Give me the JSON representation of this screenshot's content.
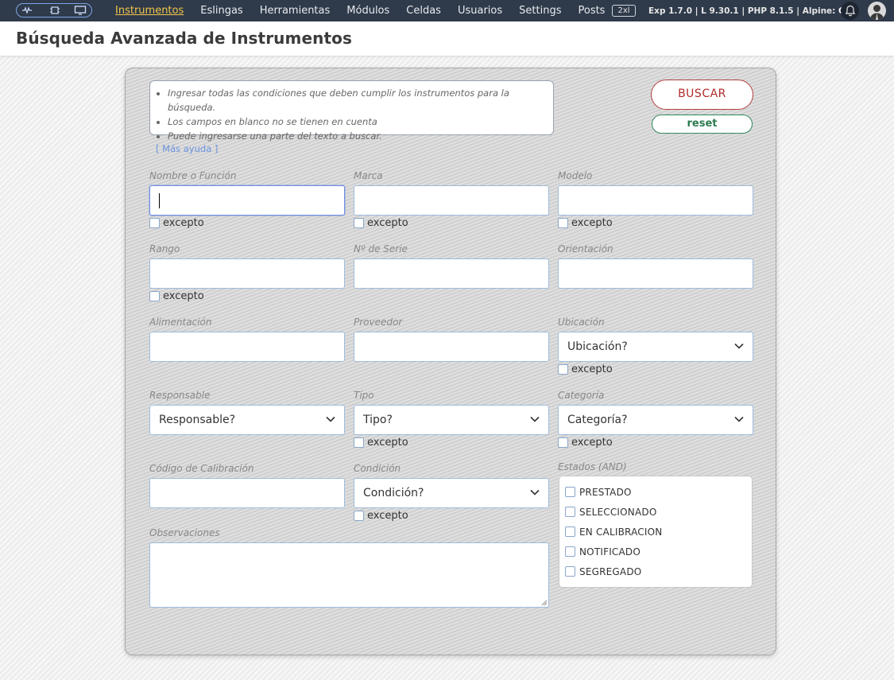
{
  "nav": {
    "items": [
      "Instrumentos",
      "Eslingas",
      "Herramientas",
      "Módulos",
      "Celdas",
      "Usuarios",
      "Settings",
      "Posts"
    ],
    "active": "Instrumentos",
    "breakpoint_badge": "2xl",
    "version_text": "Exp 1.7.0 | L 9.30.1 | PHP 8.1.5 | Alpine:",
    "version_status": "OK",
    "active_color": "#f3c64a",
    "bg_color": "#2f3a4a"
  },
  "page": {
    "title": "Búsqueda Avanzada de Instrumentos"
  },
  "help": {
    "lines": [
      "Ingresar todas las condiciones que deben cumplir los instrumentos para la búsqueda.",
      "Los campos en blanco no se tienen en cuenta",
      "Puede ingresarse una parte del texto a buscar."
    ],
    "more_link": "[ Más ayuda ]"
  },
  "buttons": {
    "search": "BUSCAR",
    "reset": "reset"
  },
  "fields": {
    "nombre": {
      "label": "Nombre o Función",
      "value": "",
      "except": "excepto"
    },
    "marca": {
      "label": "Marca",
      "value": "",
      "except": "excepto"
    },
    "modelo": {
      "label": "Modelo",
      "value": "",
      "except": "excepto"
    },
    "rango": {
      "label": "Rango",
      "value": "",
      "except": "excepto"
    },
    "serie": {
      "label": "Nº de Serie",
      "value": ""
    },
    "orientacion": {
      "label": "Orientación",
      "value": ""
    },
    "alimentacion": {
      "label": "Alimentación",
      "value": ""
    },
    "proveedor": {
      "label": "Proveedor",
      "value": ""
    },
    "ubicacion": {
      "label": "Ubicación",
      "selected": "Ubicación?",
      "except": "excepto"
    },
    "responsable": {
      "label": "Responsable",
      "selected": "Responsable?"
    },
    "tipo": {
      "label": "Tipo",
      "selected": "Tipo?",
      "except": "excepto"
    },
    "categoria": {
      "label": "Categoría",
      "selected": "Categoría?",
      "except": "excepto"
    },
    "codigo": {
      "label": "Código de Calibración",
      "value": ""
    },
    "condicion": {
      "label": "Condición",
      "selected": "Condición?",
      "except": "excepto"
    },
    "observaciones": {
      "label": "Observaciones",
      "value": ""
    }
  },
  "estados": {
    "label": "Estados (AND)",
    "options": [
      "PRESTADO",
      "SELECCIONADO",
      "EN CALIBRACION",
      "NOTIFICADO",
      "SEGREGADO"
    ]
  },
  "colors": {
    "search_border": "#b34040",
    "reset_border": "#2f8a5b",
    "help_link": "#6b95e0"
  }
}
